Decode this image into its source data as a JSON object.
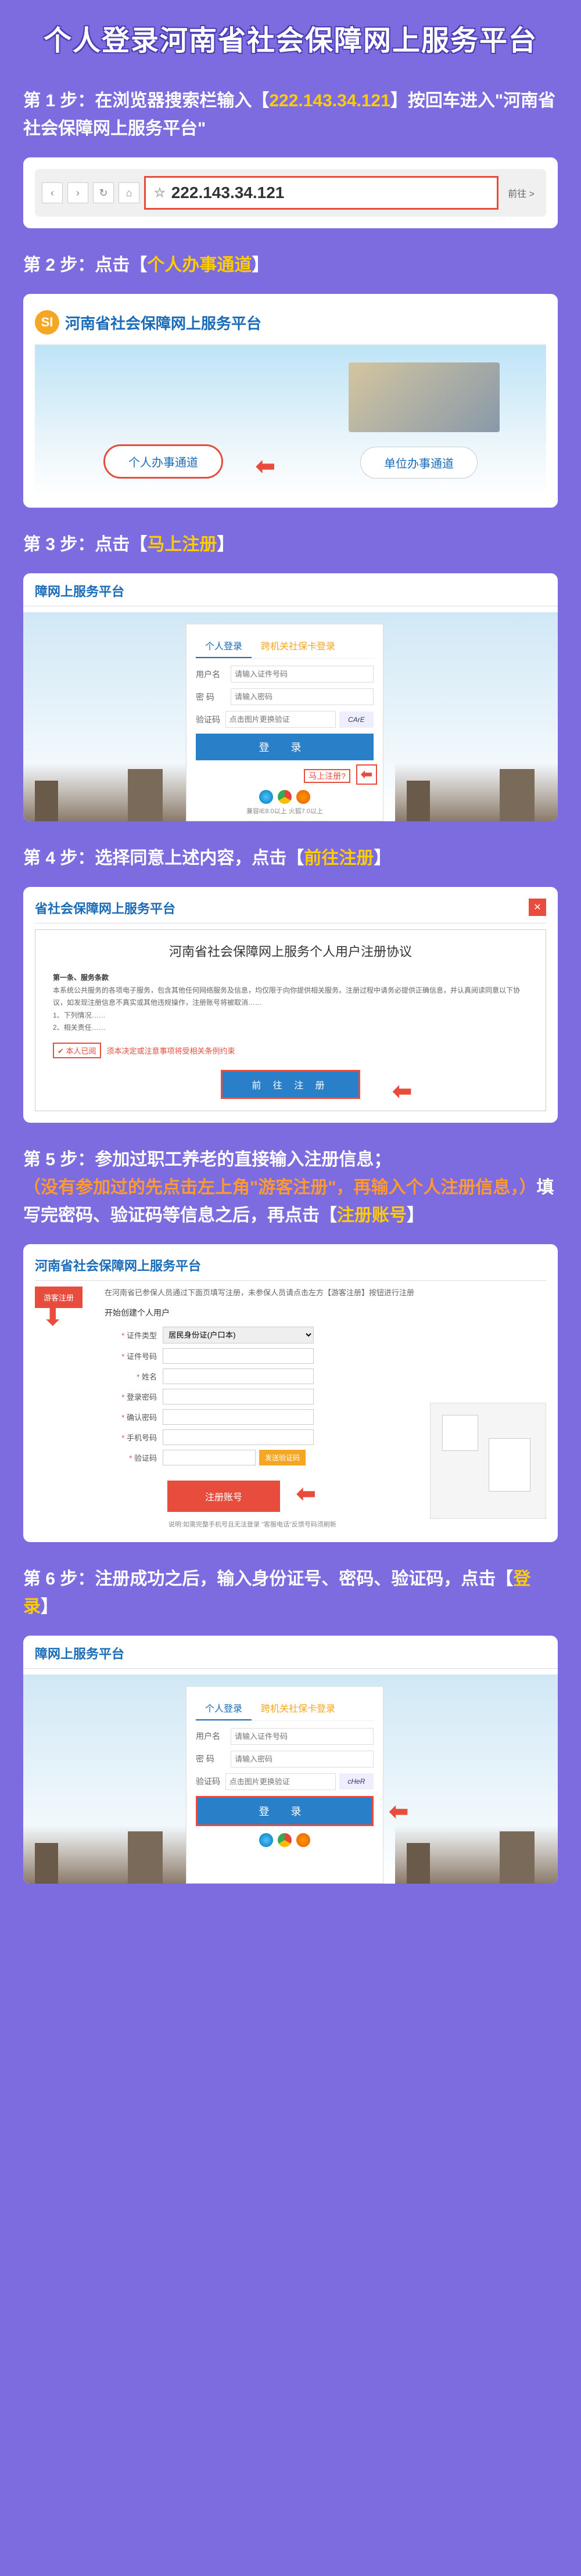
{
  "title": "个人登录河南省社会保障网上服务平台",
  "step1": {
    "label": "第 1 步：在浏览器搜索栏输入【",
    "ip": "222.143.34.121",
    "label2": "】按回车进入\"河南省社会保障网上服务平台\"",
    "url_display": "222.143.34.121",
    "go": "前往 >"
  },
  "step2": {
    "label": "第 2 步：点击【",
    "action": "个人办事通道",
    "label2": "】",
    "portal_title": "河南省社会保障网上服务平台",
    "logo": "SI",
    "personal": "个人办事通道",
    "unit": "单位办事通道"
  },
  "step3": {
    "label": "第 3 步：点击【",
    "action": "马上注册",
    "label2": "】",
    "header": "障网上服务平台",
    "tab1": "个人登录",
    "tab2": "跨机关社保卡登录",
    "user_label": "用户名",
    "user_ph": "请输入证件号码",
    "pwd_label": "密   码",
    "pwd_ph": "请输入密码",
    "cap_label": "验证码",
    "cap_ph": "点击图片更换验证",
    "cap_val": "CArE",
    "login_btn": "登   录",
    "register": "马上注册?",
    "browser_note": "兼容IE8.0以上   火狐7.0以上"
  },
  "step4": {
    "label": "第 4 步：选择同意上述内容，点击【",
    "action": "前往注册",
    "label2": "】",
    "header": "省社会保障网上服务平台",
    "agreement_title": "河南省社会保障网上服务个人用户注册协议",
    "section1": "第一条、服务条款",
    "body": "本系统公共服务的各项电子服务，包含其他任何网络服务及信息，均仅限于向你提供相关服务。注册过程中请务必提供正确信息，并认真阅读同意以下协议，如发现注册信息不真实或其他违规操作，注册账号将被取消……",
    "sub1": "1、下列情况……",
    "sub2": "2、相关责任……",
    "agree": "本人已阅",
    "agree_hint": "须本决定或注意事项将受相关条例约束",
    "proceed": "前 往 注 册"
  },
  "step5": {
    "label_a": "第 5 步：参加过职工养老的直接输入注册信息；",
    "label_b": "（没有参加过的先点击左上角\"游客注册\"，再输入个人注册信息，）",
    "label_c": "填写完密码、验证码等信息之后，再点击【",
    "action": "注册账号",
    "label_d": "】",
    "header": "河南省社会保障网上服务平台",
    "guest": "游客注册",
    "hint": "在河南省已参保人员通过下面页填写注册，未参保人员请点击左方【游客注册】按钮进行注册",
    "section_title": "开始创建个人用户",
    "f_idtype": "证件类型",
    "f_idtype_val": "居民身份证(户口本)",
    "f_idno": "证件号码",
    "f_name": "姓名",
    "f_pwd": "登录密码",
    "f_pwd2": "确认密码",
    "f_mobile": "手机号码",
    "f_vcode": "验证码",
    "send_code": "发送验证码",
    "submit": "注册账号",
    "note": "说明:如需完整手机号且无法登录 \"客服电话\"反馈号码须刷新"
  },
  "step6": {
    "label": "第 6 步：注册成功之后，输入身份证号、密码、验证码，点击【",
    "action": "登录",
    "label2": "】",
    "header": "障网上服务平台",
    "tab1": "个人登录",
    "tab2": "跨机关社保卡登录",
    "user_label": "用户名",
    "user_ph": "请输入证件号码",
    "pwd_label": "密   码",
    "pwd_ph": "请输入密码",
    "cap_label": "验证码",
    "cap_ph": "点击图片更换验证",
    "cap_val": "cHeR",
    "login_btn": "登   录"
  }
}
